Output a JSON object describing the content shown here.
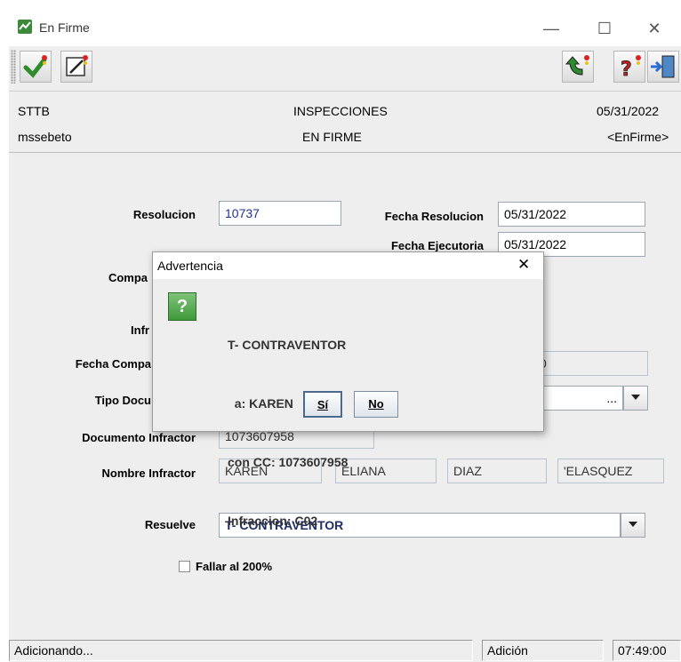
{
  "window": {
    "title": "En Firme",
    "minimize": "—",
    "maximize": "☐",
    "close": "✕"
  },
  "toolbar": {
    "left_icons": [
      "accept-icon",
      "edit-icon"
    ],
    "right_icons": [
      "undo-icon",
      "help-icon",
      "exit-icon"
    ]
  },
  "header": {
    "left_top": "STTB",
    "center_top": "INSPECCIONES",
    "right_top": "05/31/2022",
    "left_bottom": "mssebeto",
    "center_bottom": "EN FIRME",
    "right_bottom": "<EnFirme>"
  },
  "form": {
    "resolucion_label": "Resolucion",
    "resolucion_value": "10737",
    "fecha_resolucion_label": "Fecha Resolucion",
    "fecha_resolucion_value": "05/31/2022",
    "fecha_ejecutoria_label": "Fecha Ejecutoria",
    "fecha_ejecutoria_value": "05/31/2022",
    "compa_label": "Compa",
    "infr_label": "Infr",
    "fecha_compa_label": "Fecha Compa",
    "fecha_compa_value_fragment": "0",
    "tipo_docu_label": "Tipo Docu",
    "tipo_docu_button": "...",
    "documento_infractor_label": "Documento Infractor",
    "documento_infractor_value": "1073607958",
    "nombre_infractor_label": "Nombre Infractor",
    "nombre_parts": [
      "KAREN",
      "ELIANA",
      "DIAZ",
      "'ELASQUEZ"
    ],
    "resuelve_label": "Resuelve",
    "resuelve_value": "T- CONTRAVENTOR",
    "fallar_label": "Fallar al 200%",
    "fallar_checked": false
  },
  "status": {
    "left": "Adicionando...",
    "mode": "Adición",
    "time": "07:49:00"
  },
  "dialog": {
    "title": "Advertencia",
    "close": "✕",
    "icon": "question-icon",
    "icon_glyph": "?",
    "lines": [
      "T- CONTRAVENTOR",
      "  a: KAREN",
      "con CC: 1073607958",
      "Infraccion: C02"
    ],
    "yes_label": "Sí",
    "no_label": "No"
  },
  "colors": {
    "accent_green": "#3f9a3a",
    "value_blue": "#1f2f9e",
    "panel_gray": "#eeeeee"
  }
}
